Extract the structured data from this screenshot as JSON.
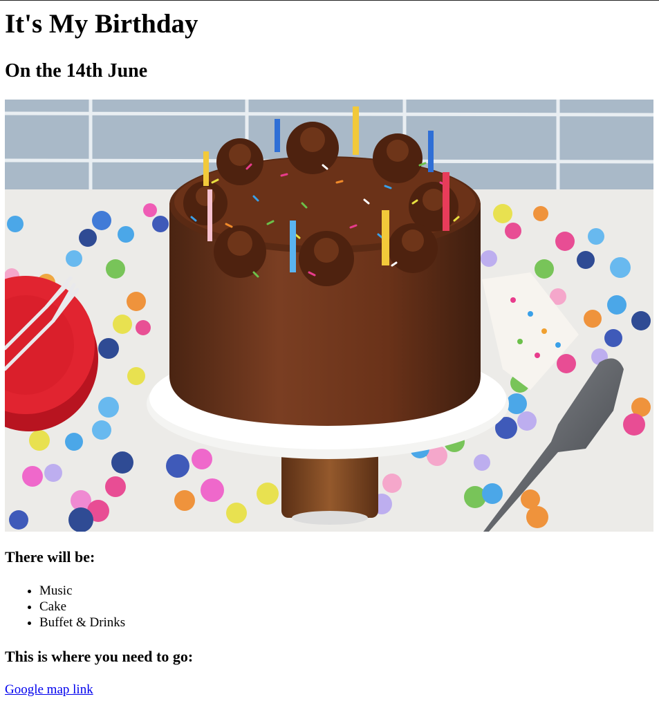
{
  "header": {
    "title": "It's My Birthday",
    "subtitle": "On the 14th June"
  },
  "image": {
    "subject": "chocolate birthday cake with candles and sprinkles on a white cake stand surrounded by colorful confetti"
  },
  "details": {
    "heading": "There will be:",
    "items": [
      "Music",
      "Cake",
      "Buffet & Drinks"
    ]
  },
  "directions": {
    "heading": "This is where you need to go:",
    "link_label": "Google map link"
  },
  "colors": {
    "link": "#0000ee",
    "text": "#000000",
    "background": "#ffffff"
  }
}
